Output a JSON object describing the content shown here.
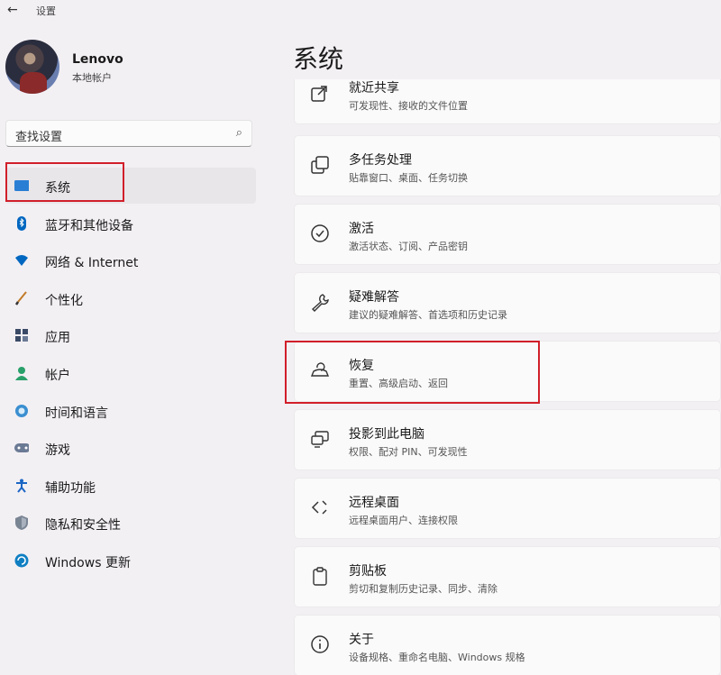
{
  "app": {
    "title": "设置",
    "back_glyph": "←"
  },
  "profile": {
    "name": "Lenovo",
    "account": "本地帐户"
  },
  "search": {
    "placeholder": "查找设置",
    "icon": "search-icon"
  },
  "sidebar": {
    "items": [
      {
        "label": "系统",
        "icon": "system-icon",
        "selected": true
      },
      {
        "label": "蓝牙和其他设备",
        "icon": "bluetooth-icon"
      },
      {
        "label": "网络 & Internet",
        "icon": "network-icon"
      },
      {
        "label": "个性化",
        "icon": "brush-icon"
      },
      {
        "label": "应用",
        "icon": "apps-icon"
      },
      {
        "label": "帐户",
        "icon": "account-icon"
      },
      {
        "label": "时间和语言",
        "icon": "clock-globe-icon"
      },
      {
        "label": "游戏",
        "icon": "gamepad-icon"
      },
      {
        "label": "辅助功能",
        "icon": "accessibility-icon"
      },
      {
        "label": "隐私和安全性",
        "icon": "shield-icon"
      },
      {
        "label": "Windows 更新",
        "icon": "update-icon"
      }
    ]
  },
  "main": {
    "title": "系统",
    "cards": [
      {
        "title": "就近共享",
        "subtitle": "可发现性、接收的文件位置",
        "icon": "share-icon"
      },
      {
        "title": "多任务处理",
        "subtitle": "贴靠窗口、桌面、任务切换",
        "icon": "multitask-icon"
      },
      {
        "title": "激活",
        "subtitle": "激活状态、订阅、产品密钥",
        "icon": "check-circle-icon"
      },
      {
        "title": "疑难解答",
        "subtitle": "建议的疑难解答、首选项和历史记录",
        "icon": "wrench-icon"
      },
      {
        "title": "恢复",
        "subtitle": "重置、高级启动、返回",
        "icon": "recovery-icon"
      },
      {
        "title": "投影到此电脑",
        "subtitle": "权限、配对 PIN、可发现性",
        "icon": "project-icon"
      },
      {
        "title": "远程桌面",
        "subtitle": "远程桌面用户、连接权限",
        "icon": "remote-desktop-icon"
      },
      {
        "title": "剪贴板",
        "subtitle": "剪切和复制历史记录、同步、清除",
        "icon": "clipboard-icon"
      },
      {
        "title": "关于",
        "subtitle": "设备规格、重命名电脑、Windows 规格",
        "icon": "info-icon"
      }
    ]
  },
  "colors": {
    "highlight": "#d11f2a",
    "accent": "#0067c0"
  }
}
